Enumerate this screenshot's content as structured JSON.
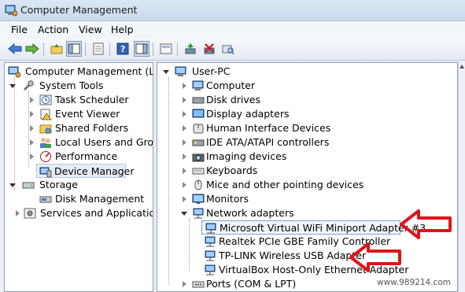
{
  "window": {
    "title": "Computer Management"
  },
  "menu": [
    "File",
    "Action",
    "View",
    "Help"
  ],
  "left_tree": {
    "root": "Computer Management (Local",
    "system_tools": "System Tools",
    "task_scheduler": "Task Scheduler",
    "event_viewer": "Event Viewer",
    "shared_folders": "Shared Folders",
    "local_users": "Local Users and Groups",
    "performance": "Performance",
    "device_manager": "Device Manager",
    "storage": "Storage",
    "disk_management": "Disk Management",
    "services": "Services and Applications"
  },
  "right_tree": {
    "root": "User-PC",
    "computer": "Computer",
    "disk_drives": "Disk drives",
    "display_adapters": "Display adapters",
    "hid": "Human Interface Devices",
    "ide": "IDE ATA/ATAPI controllers",
    "imaging": "Imaging devices",
    "keyboards": "Keyboards",
    "mice": "Mice and other pointing devices",
    "monitors": "Monitors",
    "network": "Network adapters",
    "net_1": "Microsoft Virtual WiFi Miniport Adapter #3",
    "net_2": "Realtek PCIe GBE Family Controller",
    "net_3": "TP-LINK Wireless USB Adapter",
    "net_4": "VirtualBox Host-Only Ethernet Adapter",
    "ports": "Ports (COM & LPT)"
  },
  "watermark": "www.989214.com",
  "colors": {
    "arrow": "#e0141b",
    "selection": "#e5ecf6",
    "accent": "#3a6fb0"
  }
}
